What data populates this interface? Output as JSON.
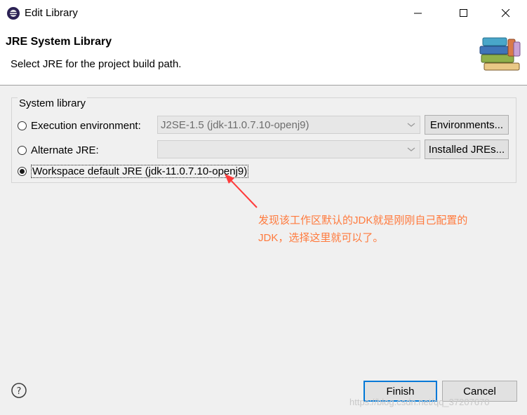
{
  "window": {
    "title": "Edit Library"
  },
  "header": {
    "title": "JRE System Library",
    "description": "Select JRE for the project build path."
  },
  "group": {
    "title": "System library",
    "options": [
      {
        "label": "Execution environment:",
        "selected": false,
        "combo_value": "J2SE-1.5 (jdk-11.0.7.10-openj9)",
        "button": "Environments..."
      },
      {
        "label": "Alternate JRE:",
        "selected": false,
        "combo_value": "",
        "button": "Installed JREs..."
      },
      {
        "label": "Workspace default JRE (jdk-11.0.7.10-openj9)",
        "selected": true
      }
    ]
  },
  "annotation": {
    "line1": "发现该工作区默认的JDK就是刚刚自己配置的",
    "line2": "JDK，选择这里就可以了。",
    "color": "#ff7a3d"
  },
  "footer": {
    "finish": "Finish",
    "cancel": "Cancel"
  },
  "watermark": "https://blog.csdn.net/qq_37207670",
  "icons": {
    "app": "eclipse-icon",
    "help": "help-icon",
    "banner": "library-books-icon"
  },
  "colors": {
    "accent": "#0078d7",
    "annotation": "#ff7a3d"
  }
}
